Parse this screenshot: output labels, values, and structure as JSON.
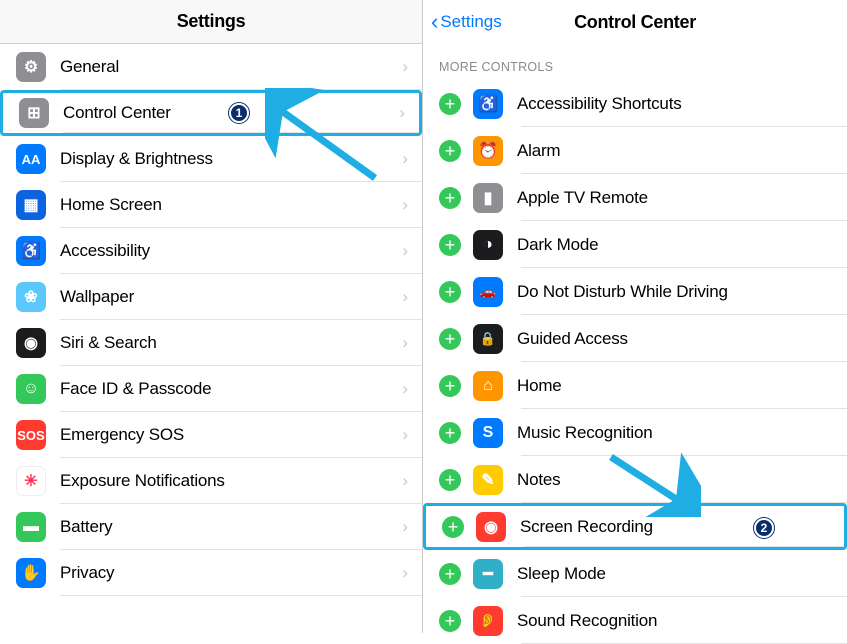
{
  "left": {
    "title": "Settings",
    "rows": [
      {
        "label": "General",
        "icon": "gear-icon",
        "bg": "bg-gray",
        "glyph": "⚙"
      },
      {
        "label": "Control Center",
        "icon": "control-center-icon",
        "bg": "bg-gray",
        "glyph": "⊞",
        "highlighted": true,
        "badge": "1"
      },
      {
        "label": "Display & Brightness",
        "icon": "display-icon",
        "bg": "bg-blue",
        "glyph": "AA"
      },
      {
        "label": "Home Screen",
        "icon": "home-screen-icon",
        "bg": "bg-dblue",
        "glyph": "▦"
      },
      {
        "label": "Accessibility",
        "icon": "accessibility-icon",
        "bg": "bg-blue",
        "glyph": "♿"
      },
      {
        "label": "Wallpaper",
        "icon": "wallpaper-icon",
        "bg": "bg-cyan",
        "glyph": "❀"
      },
      {
        "label": "Siri & Search",
        "icon": "siri-icon",
        "bg": "bg-black",
        "glyph": "◉"
      },
      {
        "label": "Face ID & Passcode",
        "icon": "faceid-icon",
        "bg": "bg-green",
        "glyph": "☺"
      },
      {
        "label": "Emergency SOS",
        "icon": "sos-icon",
        "bg": "bg-red",
        "glyph": "SOS"
      },
      {
        "label": "Exposure Notifications",
        "icon": "exposure-icon",
        "bg": "",
        "glyph": "✳",
        "whiteBg": true
      },
      {
        "label": "Battery",
        "icon": "battery-icon",
        "bg": "bg-green",
        "glyph": "▬"
      },
      {
        "label": "Privacy",
        "icon": "privacy-icon",
        "bg": "bg-blue",
        "glyph": "✋"
      }
    ]
  },
  "right": {
    "back_label": "Settings",
    "title": "Control Center",
    "section": "More Controls",
    "rows": [
      {
        "label": "Accessibility Shortcuts",
        "icon": "accessibility-icon",
        "bg": "bg-blue",
        "glyph": "♿"
      },
      {
        "label": "Alarm",
        "icon": "alarm-icon",
        "bg": "bg-orange",
        "glyph": "⏰"
      },
      {
        "label": "Apple TV Remote",
        "icon": "tv-remote-icon",
        "bg": "bg-gray",
        "glyph": "▮"
      },
      {
        "label": "Dark Mode",
        "icon": "dark-mode-icon",
        "bg": "bg-black",
        "glyph": "◑"
      },
      {
        "label": "Do Not Disturb While Driving",
        "icon": "dnd-driving-icon",
        "bg": "bg-blue",
        "glyph": "🚗"
      },
      {
        "label": "Guided Access",
        "icon": "guided-access-icon",
        "bg": "bg-black",
        "glyph": "🔒"
      },
      {
        "label": "Home",
        "icon": "home-icon",
        "bg": "bg-orange",
        "glyph": "⌂"
      },
      {
        "label": "Music Recognition",
        "icon": "shazam-icon",
        "bg": "bg-blue",
        "glyph": "S"
      },
      {
        "label": "Notes",
        "icon": "notes-icon",
        "bg": "bg-yellow",
        "glyph": "✎"
      },
      {
        "label": "Screen Recording",
        "icon": "screen-recording-icon",
        "bg": "bg-red",
        "glyph": "◉",
        "highlighted": true,
        "badge": "2"
      },
      {
        "label": "Sleep Mode",
        "icon": "sleep-icon",
        "bg": "bg-teal",
        "glyph": "━"
      },
      {
        "label": "Sound Recognition",
        "icon": "sound-recognition-icon",
        "bg": "bg-red",
        "glyph": "👂"
      }
    ]
  }
}
